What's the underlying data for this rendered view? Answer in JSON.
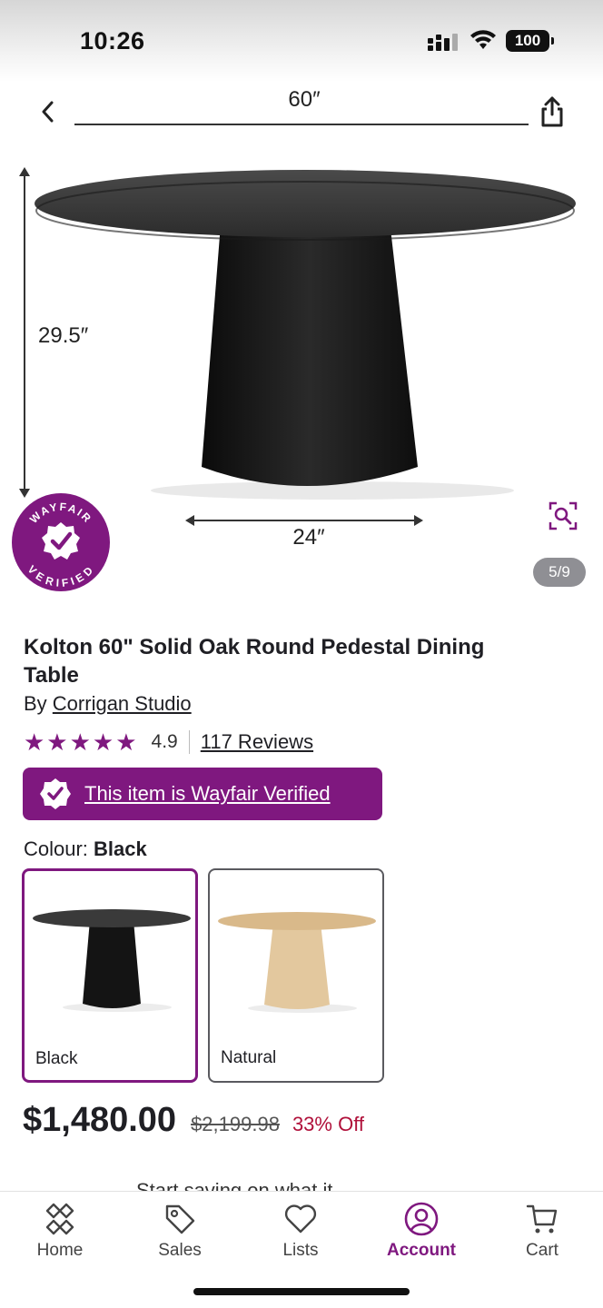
{
  "status_bar": {
    "time": "10:26",
    "battery": "100"
  },
  "hero": {
    "dimension_top": "60″",
    "dimension_side": "29.5″",
    "dimension_base": "24″",
    "seal_top_text": "WAYFAIR",
    "seal_bottom_text": "VERIFIED",
    "page_indicator": "5/9"
  },
  "product": {
    "title": "Kolton 60\" Solid Oak Round Pedestal Dining Table",
    "by_prefix": "By ",
    "brand": "Corrigan Studio",
    "stars": "★★★★★",
    "rating": "4.9",
    "reviews": "117 Reviews",
    "verified_banner": "This item is Wayfair Verified"
  },
  "colour": {
    "label": "Colour: ",
    "selected": "Black",
    "options": [
      {
        "label": "Black",
        "selected": true
      },
      {
        "label": "Natural",
        "selected": false
      }
    ]
  },
  "price": {
    "current": "$1,480.00",
    "original": "$2,199.98",
    "discount": "33% Off"
  },
  "peek_text": "Start saving on what it",
  "nav": {
    "items": [
      {
        "label": "Home",
        "icon": "home-icon"
      },
      {
        "label": "Sales",
        "icon": "tag-icon"
      },
      {
        "label": "Lists",
        "icon": "heart-icon"
      },
      {
        "label": "Account",
        "icon": "account-icon",
        "active": true
      },
      {
        "label": "Cart",
        "icon": "cart-icon"
      }
    ]
  },
  "colors": {
    "brand": "#7f187f",
    "discount": "#b0103a"
  }
}
